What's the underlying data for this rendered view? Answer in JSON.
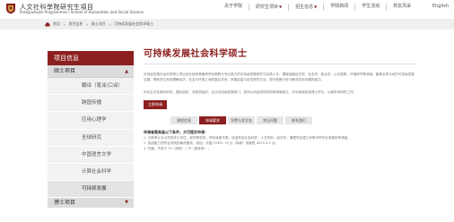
{
  "header": {
    "school_cn": "人文社科學院研究生項目",
    "school_en": "Postgraduate Programmes I School of Humanities and Social Science",
    "nav": [
      "关于学院",
      "研究生项目",
      "招生信息",
      "学院新闻",
      "学生活动",
      "校友风采"
    ],
    "lang": "English",
    "brand_color": "#8c1f1f"
  },
  "breadcrumb": [
    "首页",
    "项目信息",
    "硕士项目",
    "可持续发展社会科学硕士"
  ],
  "sidebar": {
    "heading": "项目信息",
    "section": "硕士项目",
    "items": [
      "翻译（笔译/口译）",
      "跨国传播",
      "应用心理学",
      "全球研究",
      "中国语言文学",
      "计算社会科学",
      "可持续发展"
    ],
    "footer": "博士项目"
  },
  "main": {
    "title": "可持续发展社会科学硕士",
    "para1": "可持续发展社会科学硕士项目旨在培养具备跨学科视野与专业能力的可持续发展研究与实践人才。课程涵盖经济学、社会学、政治学、公共政策、环境研究等领域，聚焦全球与地方可持续发展议题，帮助学生系统理解经济、社会与环境之间的复杂关系，掌握定量与定性研究方法，提升政策分析与解决实际问题的能力。",
    "para2": "毕业生可在政府机构、国际组织、非政府组织、企业可持续发展部门、咨询公司及研究机构等领域就业，亦可继续攻读博士学位，从事学术研究工作。",
    "apply_label": "立即申请",
    "tabs": [
      "课程信息",
      "申请要求",
      "学费与奖学金",
      "常见问题",
      "联系我们"
    ],
    "active_tab": "申请要求",
    "tab_lead": "申请者需具备以下条件，方可提交申请：",
    "tab_text1": "1. 已获得认可大学的学士学位，或同等学历；学科背景不限，欢迎来自社会科学、人文学科、经济学、管理学及理工科等不同专业背景的申请者。",
    "tab_text2": "2. 英语能力须符合学院的最低要求，例如：托福 TOEFL 79 分（网考）或雅思 IELTS 6.5 分。",
    "tab_text3": "3. 托福：不低于 79（网考）/ 79（居家考）；"
  }
}
